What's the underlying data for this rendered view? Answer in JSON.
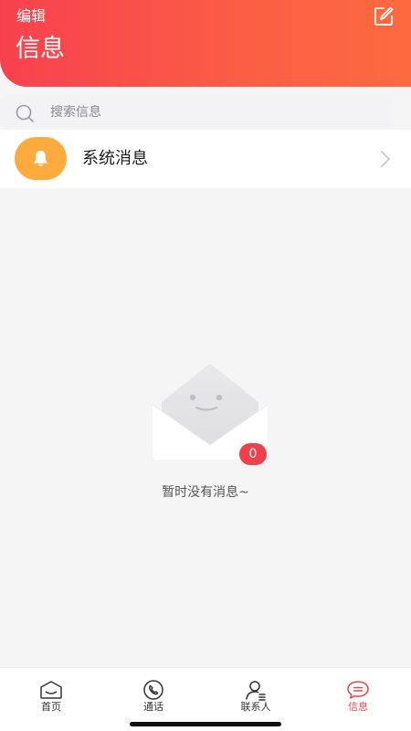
{
  "header": {
    "edit_label": "编辑",
    "title": "信息"
  },
  "search": {
    "placeholder": "搜索信息"
  },
  "system_message": {
    "title": "系统消息",
    "icon": "bell-icon",
    "avatar_color": "#fcab3c"
  },
  "empty_state": {
    "text": "暂时没有消息~",
    "badge_count": "0"
  },
  "tabbar": {
    "tabs": [
      {
        "label": "首页",
        "icon": "home-icon",
        "active": false
      },
      {
        "label": "通话",
        "icon": "phone-icon",
        "active": false
      },
      {
        "label": "联系人",
        "icon": "contacts-icon",
        "active": false
      },
      {
        "label": "信息",
        "icon": "message-icon",
        "active": true
      }
    ]
  },
  "colors": {
    "accent": "#f7414f",
    "accent_end": "#fd6a3f",
    "active_tab": "#e84a4f"
  }
}
